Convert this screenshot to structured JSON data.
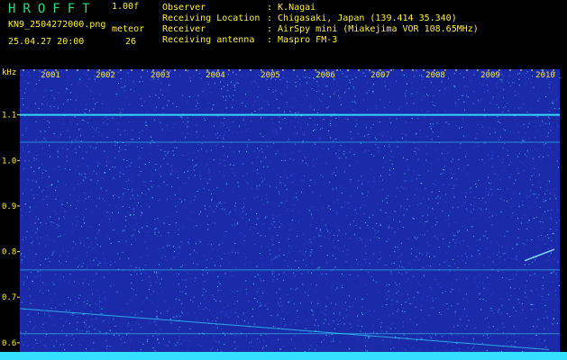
{
  "header": {
    "app_title": "HROFFT",
    "version": "1.00f",
    "filename": "KN9_2504272000.png",
    "meteor_label": "meteor",
    "timestamp": "25.04.27 20:00",
    "meteor_count": "26"
  },
  "info": [
    {
      "label": "Observer",
      "value": ": K.Nagai"
    },
    {
      "label": "Receiving Location",
      "value": ": Chigasaki, Japan (139.414 35.340)"
    },
    {
      "label": "Receiver",
      "value": ": AirSpy mini (Miakejima VOR 108.65MHz)"
    },
    {
      "label": "Receiving antenna",
      "value": ": Maspro FM-3"
    }
  ],
  "colors": {
    "background": "#1a2aa8",
    "title_green": "#22e07a",
    "label_yellow": "#ffee33",
    "signal_cyan": "#33e0ff"
  },
  "chart_data": {
    "type": "heatmap",
    "yunit": "kHz",
    "ylim": [
      0.58,
      1.2
    ],
    "yticks": [
      {
        "value": 1.1,
        "label": "1.1"
      },
      {
        "value": 1.0,
        "label": "1.0"
      },
      {
        "value": 0.9,
        "label": "0.9"
      },
      {
        "value": 0.8,
        "label": "0.8"
      },
      {
        "value": 0.7,
        "label": "0.7"
      },
      {
        "value": 0.6,
        "label": "0.6"
      }
    ],
    "xticks": [
      "2001",
      "2002",
      "2003",
      "2004",
      "2005",
      "2006",
      "2007",
      "2008",
      "2009",
      "2010"
    ],
    "xunit": "",
    "horizontal_lines": [
      1.1,
      1.04,
      0.76,
      0.62
    ],
    "diagonal_trace": {
      "start": [
        0,
        0.675
      ],
      "end": [
        0.98,
        0.585
      ]
    },
    "short_trace": {
      "start": [
        0.935,
        0.78
      ],
      "end": [
        0.99,
        0.805
      ]
    }
  }
}
